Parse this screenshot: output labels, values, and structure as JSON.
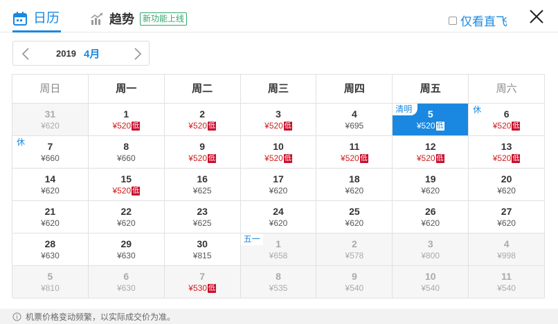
{
  "header": {
    "calendar_tab": "日历",
    "trend_tab": "趋势",
    "new_badge": "新功能上线",
    "direct_only": "仅看直飞"
  },
  "month_selector": {
    "year": "2019",
    "month": "4月"
  },
  "weekdays": [
    "周日",
    "周一",
    "周二",
    "周三",
    "周四",
    "周五",
    "周六"
  ],
  "weeks": [
    [
      {
        "day": "31",
        "price": "¥620",
        "other": true
      },
      {
        "day": "1",
        "price": "¥520",
        "low": true
      },
      {
        "day": "2",
        "price": "¥520",
        "low": true
      },
      {
        "day": "3",
        "price": "¥520",
        "low": true
      },
      {
        "day": "4",
        "price": "¥695"
      },
      {
        "day": "5",
        "price": "¥520",
        "low": true,
        "selected": true,
        "tag": "清明"
      },
      {
        "day": "6",
        "price": "¥520",
        "low": true,
        "tag": "休"
      }
    ],
    [
      {
        "day": "7",
        "price": "¥660",
        "tag": "休"
      },
      {
        "day": "8",
        "price": "¥660"
      },
      {
        "day": "9",
        "price": "¥520",
        "low": true
      },
      {
        "day": "10",
        "price": "¥520",
        "low": true
      },
      {
        "day": "11",
        "price": "¥520",
        "low": true
      },
      {
        "day": "12",
        "price": "¥520",
        "low": true
      },
      {
        "day": "13",
        "price": "¥520",
        "low": true
      }
    ],
    [
      {
        "day": "14",
        "price": "¥620"
      },
      {
        "day": "15",
        "price": "¥520",
        "low": true
      },
      {
        "day": "16",
        "price": "¥625"
      },
      {
        "day": "17",
        "price": "¥620"
      },
      {
        "day": "18",
        "price": "¥620"
      },
      {
        "day": "19",
        "price": "¥620"
      },
      {
        "day": "20",
        "price": "¥620"
      }
    ],
    [
      {
        "day": "21",
        "price": "¥620"
      },
      {
        "day": "22",
        "price": "¥620"
      },
      {
        "day": "23",
        "price": "¥625"
      },
      {
        "day": "24",
        "price": "¥620"
      },
      {
        "day": "25",
        "price": "¥620"
      },
      {
        "day": "26",
        "price": "¥620"
      },
      {
        "day": "27",
        "price": "¥620"
      }
    ],
    [
      {
        "day": "28",
        "price": "¥630"
      },
      {
        "day": "29",
        "price": "¥630"
      },
      {
        "day": "30",
        "price": "¥815"
      },
      {
        "day": "1",
        "price": "¥658",
        "other": true,
        "tag": "五一"
      },
      {
        "day": "2",
        "price": "¥578",
        "other": true
      },
      {
        "day": "3",
        "price": "¥800",
        "other": true
      },
      {
        "day": "4",
        "price": "¥998",
        "other": true
      }
    ],
    [
      {
        "day": "5",
        "price": "¥810",
        "other": true
      },
      {
        "day": "6",
        "price": "¥630",
        "other": true
      },
      {
        "day": "7",
        "price": "¥530",
        "other": true,
        "low": true
      },
      {
        "day": "8",
        "price": "¥535",
        "other": true
      },
      {
        "day": "9",
        "price": "¥540",
        "other": true
      },
      {
        "day": "10",
        "price": "¥540",
        "other": true
      },
      {
        "day": "11",
        "price": "¥540",
        "other": true
      }
    ]
  ],
  "low_label": "低",
  "footer": {
    "notice": "机票价格变动频繁，以实际成交价为准。"
  },
  "colors": {
    "accent": "#1a88e0",
    "low_price": "#d01b1b",
    "low_tag": "#c8102e",
    "new_badge": "#2ea66a"
  }
}
